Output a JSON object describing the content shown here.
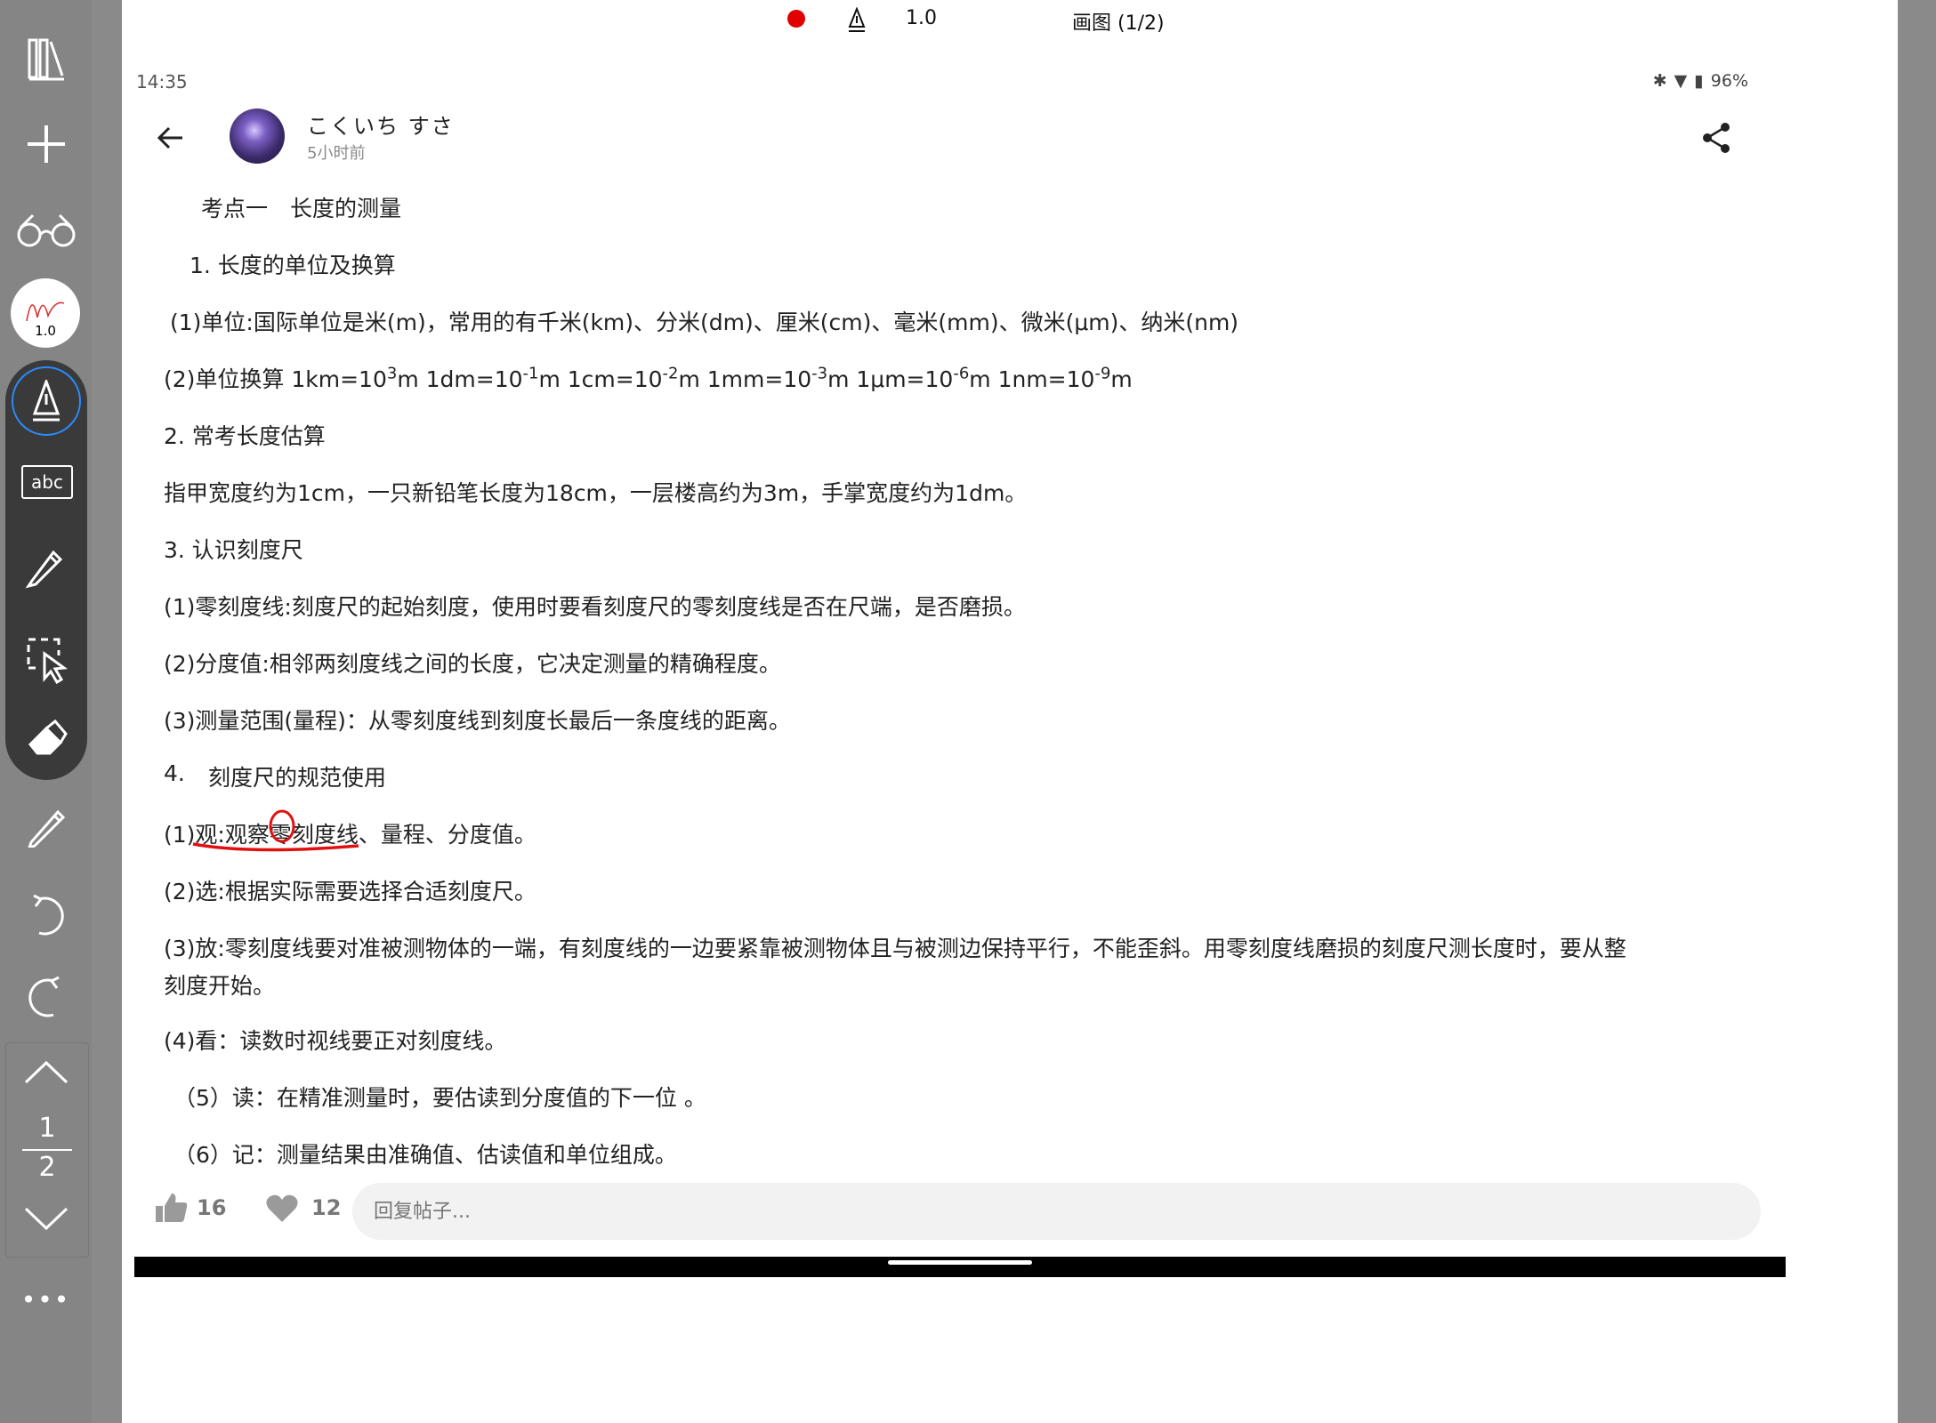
{
  "toolbar": {
    "pen_size": "1.0",
    "abc_label": "abc",
    "page_current": "1",
    "page_total": "2",
    "more": "•••"
  },
  "topbar": {
    "pen_size": "1.0",
    "title": "画图 (1/2)"
  },
  "status": {
    "time": "14:35",
    "battery": "96%"
  },
  "post": {
    "author": "こくいち すさ",
    "time": "5小时前"
  },
  "content": {
    "l1": "考点一　长度的测量",
    "l2": "1.  长度的单位及换算",
    "l3": "(1)单位:国际单位是米(m)，常用的有千米(km)、分米(dm)、厘米(cm)、毫米(mm)、微米(μm)、纳米(nm)",
    "l4_a": "(2)单位换算  1km=10",
    "l4_a_exp": "3",
    "l4_b": "m  1dm=10",
    "l4_b_exp": "-1",
    "l4_c": "m   1cm=10",
    "l4_c_exp": "-2",
    "l4_d": "m   1mm=10",
    "l4_d_exp": "-3",
    "l4_e": "m   1μm=10",
    "l4_e_exp": "-6",
    "l4_f": "m    1nm=10",
    "l4_f_exp": "-9",
    "l4_g": "m",
    "l5": "2.  常考长度估算",
    "l6": "指甲宽度约为1cm，一只新铅笔长度为18cm，一层楼高约为3m，手掌宽度约为1dm。",
    "l7": "3.   认识刻度尺",
    "l8": "(1)零刻度线:刻度尺的起始刻度，使用时要看刻度尺的零刻度线是否在尺端，是否磨损。",
    "l9": "(2)分度值:相邻两刻度线之间的长度，它决定测量的精确程度。",
    "l10": "(3)测量范围(量程)：从零刻度线到刻度长最后一条度线的距离。",
    "l11_num": "4.",
    "l11": "刻度尺的规范使用",
    "l12": "(1)观:观察零刻度线、量程、分度值。",
    "l13": "(2)选:根据实际需要选择合适刻度尺。",
    "l14": "(3)放:零刻度线要对准被测物体的一端，有刻度线的一边要紧靠被测物体且与被测边保持平行，不能歪斜。用零刻度线磨损的刻度尺测长度时，要从整",
    "l15": "刻度开始。",
    "l16": "(4)看：读数时视线要正对刻度线。",
    "l17": "（5）读：在精准测量时，要估读到分度值的下一位 。",
    "l18": "（6）记：测量结果由准确值、估读值和单位组成。"
  },
  "footer": {
    "likes": "16",
    "hearts": "12",
    "reply_placeholder": "回复帖子..."
  },
  "colors": {
    "annotation": "#e01010",
    "record": "#e00000"
  }
}
